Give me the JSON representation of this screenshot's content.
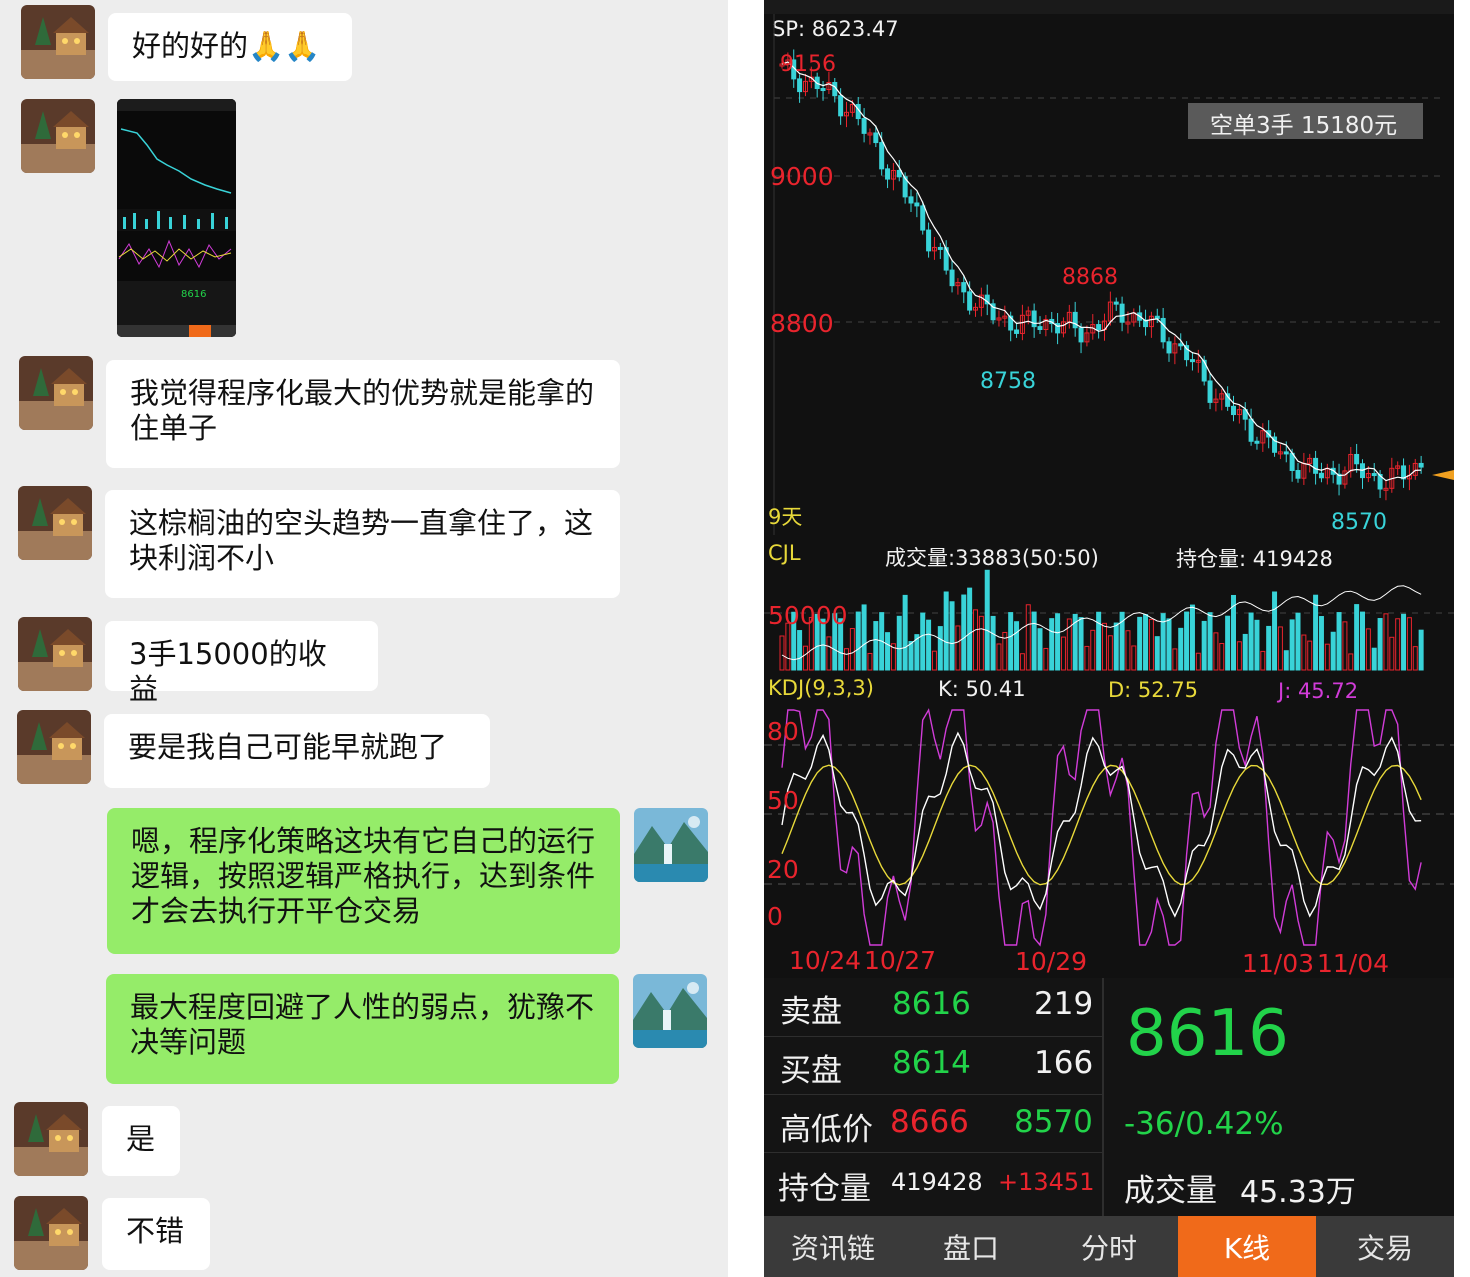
{
  "chat": {
    "messages": [
      {
        "side": "left",
        "text": "好的好的🙏🙏"
      },
      {
        "side": "left",
        "type": "image"
      },
      {
        "side": "left",
        "text": "我觉得程序化最大的优势就是能拿的住单子"
      },
      {
        "side": "left",
        "text": "这棕榈油的空头趋势一直拿住了，这块利润不小"
      },
      {
        "side": "left",
        "text": "3手15000的收益"
      },
      {
        "side": "left",
        "text": "要是我自己可能早就跑了"
      },
      {
        "side": "right",
        "text": "嗯，程序化策略这块有它自己的运行逻辑，按照逻辑严格执行，达到条件才会去执行开平仓交易"
      },
      {
        "side": "right",
        "text": "最大程度回避了人性的弱点，犹豫不决等问题"
      },
      {
        "side": "left",
        "text": "是"
      },
      {
        "side": "left",
        "text": "不错"
      }
    ]
  },
  "market": {
    "sp": "SP: 8623.47",
    "position_label": "空单3手  15180元",
    "price_labels": {
      "p9156": "9156",
      "p9000": "9000",
      "p8868": "8868",
      "p8800": "8800",
      "p8758": "8758",
      "p8570": "8570"
    },
    "days_label": "9天",
    "volume": {
      "cjl": "CJL",
      "volume_text": "成交量:33883(50:50)",
      "oi_text": "持仓量: 419428",
      "level": "50000"
    },
    "kdj": {
      "label": "KDJ(9,3,3)",
      "k": "K: 50.41",
      "d": "D: 52.75",
      "j": "J: 45.72",
      "levels": [
        "80",
        "50",
        "20",
        "0"
      ]
    },
    "dates": [
      "10/24",
      "10/27",
      "10/29",
      "11/03",
      "11/04"
    ],
    "quote": {
      "sell_label": "卖盘",
      "sell_price": "8616",
      "sell_qty": "219",
      "buy_label": "买盘",
      "buy_price": "8614",
      "buy_qty": "166",
      "hl_label": "高低价",
      "high": "8666",
      "low": "8570",
      "oi_label": "持仓量",
      "oi_value": "419428",
      "oi_change": "+13451",
      "last": "8616",
      "change": "-36/0.42%",
      "vol_label": "成交量",
      "vol_value": "45.33万"
    },
    "tabs": [
      "资讯链",
      "盘口",
      "分时",
      "K线",
      "交易"
    ],
    "active_tab": "K线",
    "colors": {
      "up": "#e8242d",
      "down": "#39d3d8",
      "accent": "#f06a1a",
      "positive": "#22d34a"
    }
  },
  "chart_data": {
    "type": "candlestick",
    "title": "",
    "x": [
      "10/24",
      "10/27",
      "10/29",
      "11/03",
      "11/04"
    ],
    "series": [
      {
        "values": [
          9140,
          9120,
          9090,
          9020,
          8950,
          8860,
          8820,
          8800,
          8805,
          8790,
          8820,
          8800,
          8760,
          8700,
          8660,
          8620,
          8600,
          8610,
          8590,
          8616
        ]
      }
    ],
    "annotations": [
      "9156",
      "8868",
      "8758",
      "8570"
    ],
    "ylim": [
      8540,
      9180
    ]
  }
}
